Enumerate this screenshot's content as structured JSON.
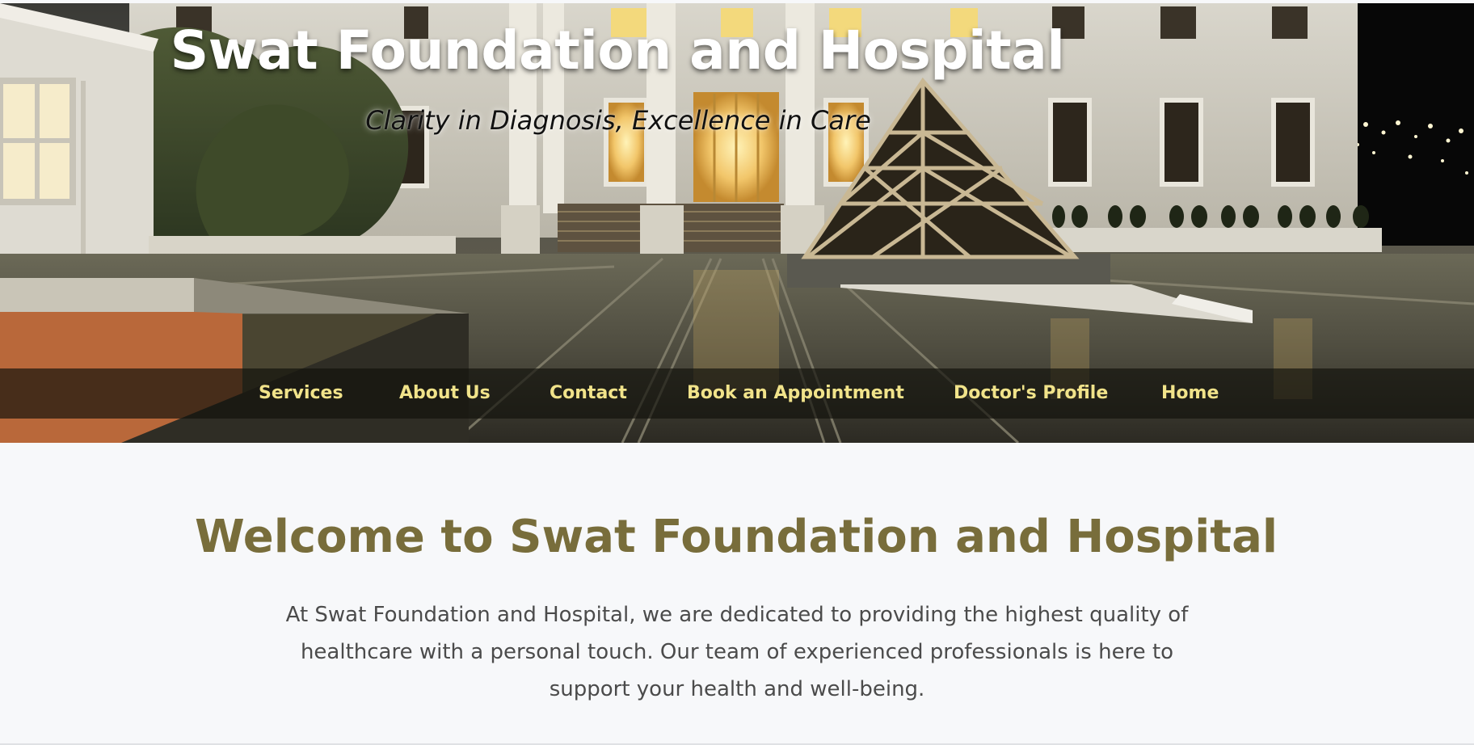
{
  "hero": {
    "title": "Swat Foundation and Hospital",
    "tagline": "Clarity in Diagnosis, Excellence in Care",
    "background_image": "hospital-building-night-photo"
  },
  "nav": {
    "items": [
      {
        "label": "Services"
      },
      {
        "label": "About Us"
      },
      {
        "label": "Contact"
      },
      {
        "label": "Book an Appointment"
      },
      {
        "label": "Doctor's Profile"
      },
      {
        "label": "Home"
      }
    ]
  },
  "welcome": {
    "title": "Welcome to Swat Foundation and Hospital",
    "text": "At Swat Foundation and Hospital, we are dedicated to providing the highest quality of healthcare with a personal touch. Our team of experienced professionals is here to support your health and well-being."
  },
  "colors": {
    "nav_text": "#f1e38a",
    "welcome_title": "#786d3b",
    "body_text": "#4b4b4b",
    "page_background": "#f7f8fa"
  }
}
